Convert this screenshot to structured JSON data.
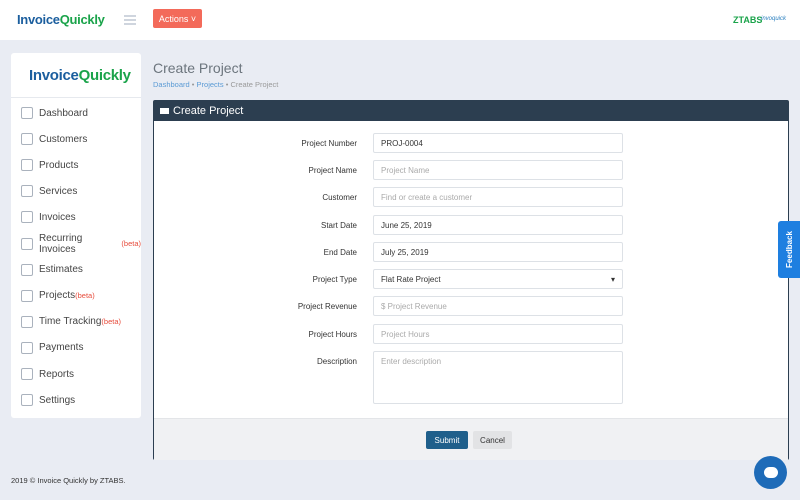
{
  "app": {
    "logo_a": "Invoice",
    "logo_b": "Quickly",
    "actions_label": "Actions ˅",
    "ztabs": "ZTABS",
    "partner_logo": "invoquick"
  },
  "sidebar": {
    "items": [
      {
        "label": "Dashboard",
        "beta": ""
      },
      {
        "label": "Customers",
        "beta": ""
      },
      {
        "label": "Products",
        "beta": ""
      },
      {
        "label": "Services",
        "beta": ""
      },
      {
        "label": "Invoices",
        "beta": ""
      },
      {
        "label": "Recurring Invoices",
        "beta": "(beta)"
      },
      {
        "label": "Estimates",
        "beta": ""
      },
      {
        "label": "Projects",
        "beta": "(beta)"
      },
      {
        "label": "Time Tracking",
        "beta": "(beta)"
      },
      {
        "label": "Payments",
        "beta": ""
      },
      {
        "label": "Reports",
        "beta": ""
      },
      {
        "label": "Settings",
        "beta": ""
      }
    ]
  },
  "page": {
    "title": "Create Project",
    "breadcrumb": [
      "Dashboard",
      "Projects",
      "Create Project"
    ],
    "sep": "•"
  },
  "form": {
    "header": "Create Project",
    "fields": [
      {
        "label": "Project Number",
        "value": "PROJ-0004",
        "placeholder": ""
      },
      {
        "label": "Project Name",
        "value": "",
        "placeholder": "Project Name"
      },
      {
        "label": "Customer",
        "value": "",
        "placeholder": "Find or create a customer"
      },
      {
        "label": "Start Date",
        "value": "June 25, 2019",
        "placeholder": ""
      },
      {
        "label": "End Date",
        "value": "July 25, 2019",
        "placeholder": ""
      },
      {
        "label": "Project Type",
        "value": "Flat Rate Project",
        "placeholder": ""
      },
      {
        "label": "Project Revenue",
        "value": "",
        "placeholder": "$   Project Revenue"
      },
      {
        "label": "Project Hours",
        "value": "",
        "placeholder": "Project Hours"
      },
      {
        "label": "Description",
        "value": "",
        "placeholder": "Enter description"
      }
    ],
    "submit": "Submit",
    "cancel": "Cancel"
  },
  "footer": "2019 © Invoice Quickly by ZTABS.",
  "feedback": "Feedback"
}
